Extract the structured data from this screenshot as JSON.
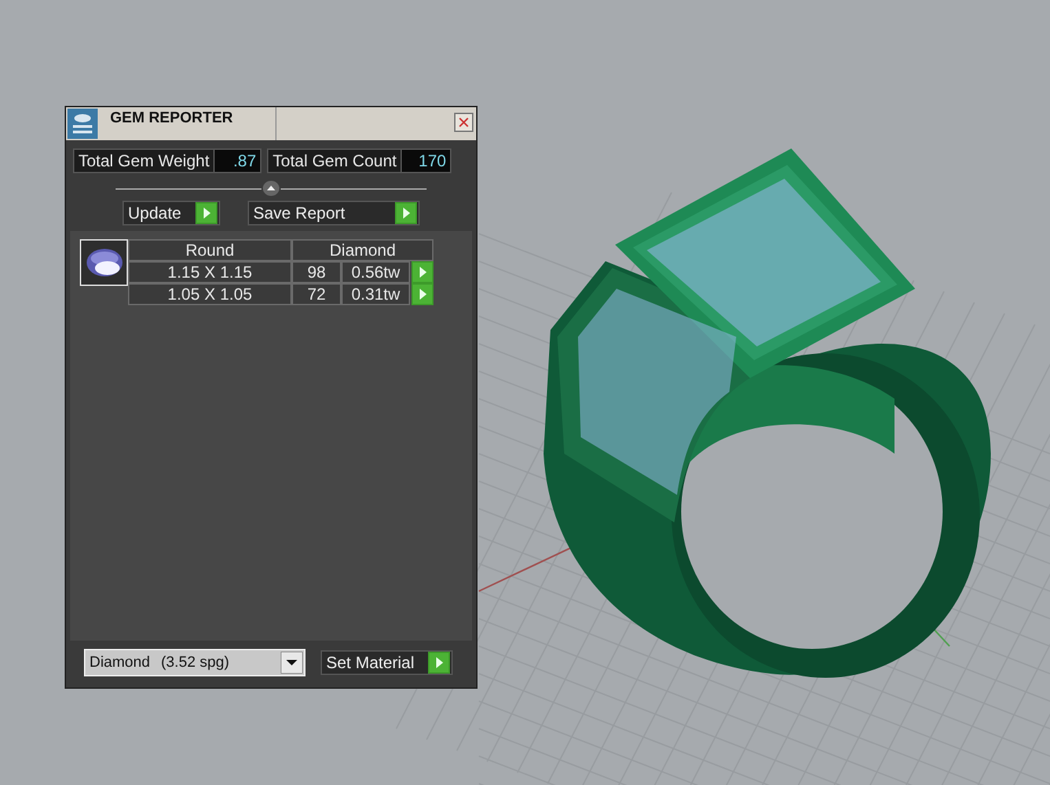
{
  "window": {
    "title": "GEM REPORTER"
  },
  "totals": [
    {
      "label": "Total Gem Weight",
      "value": ".87"
    },
    {
      "label": "Total Gem Count",
      "value": "170"
    }
  ],
  "buttons": {
    "update": "Update",
    "save_report": "Save Report",
    "set_material": "Set Material"
  },
  "gem_table": {
    "shape": "Round",
    "material": "Diamond",
    "rows": [
      {
        "size": "1.15 X 1.15",
        "count": "98",
        "weight": "0.56tw"
      },
      {
        "size": "1.05 X 1.05",
        "count": "72",
        "weight": "0.31tw"
      }
    ]
  },
  "material_select": {
    "value": "Diamond",
    "density": "(3.52 spg)"
  }
}
